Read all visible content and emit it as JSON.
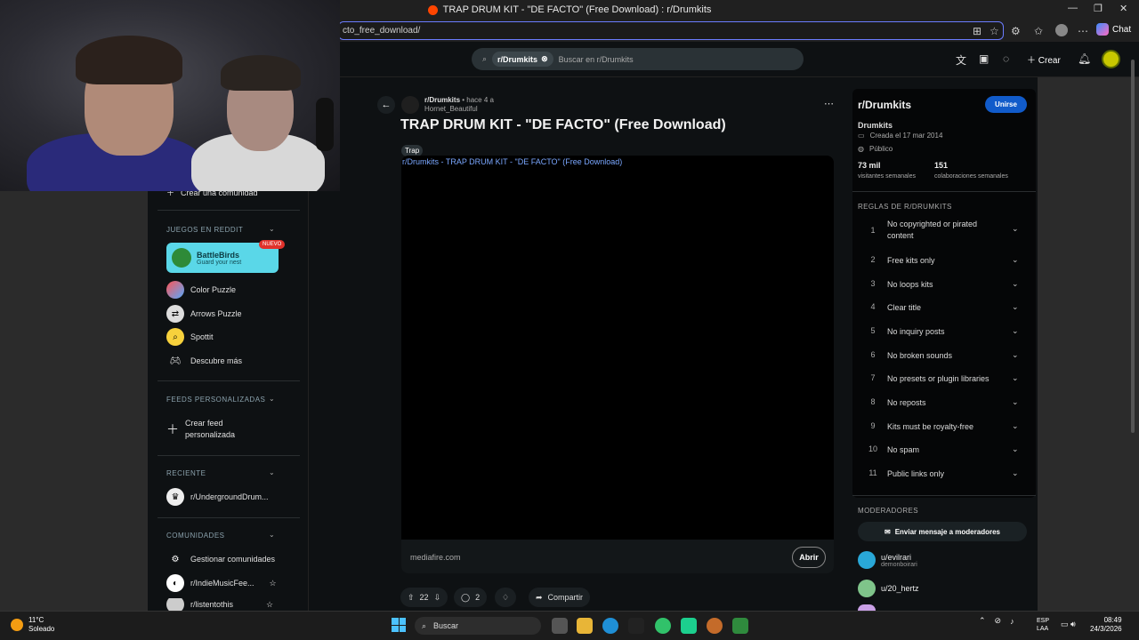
{
  "browser": {
    "tab_title": "TRAP DRUM KIT - \"DE FACTO\" (Free Download) : r/Drumkits",
    "address": "cto_free_download/",
    "chat_label": "Chat"
  },
  "header": {
    "search_chip": "r/Drumkits",
    "search_placeholder": "Buscar en r/Drumkits",
    "create_label": "Crear"
  },
  "left_sidebar": {
    "create_community": "Crear una comunidad",
    "games_header": "JUEGOS EN REDDIT",
    "battle": {
      "title": "BattleBirds",
      "subtitle": "Guard your nest",
      "badge": "NUEVO"
    },
    "games": [
      "Color Puzzle",
      "Arrows Puzzle",
      "Spottit",
      "Descubre más"
    ],
    "feeds_header": "FEEDS PERSONALIZADAS",
    "create_feed": "Crear feed personalizada",
    "recent_header": "RECIENTE",
    "recent": [
      "r/UndergroundDrum..."
    ],
    "communities_header": "COMUNIDADES",
    "communities": [
      "Gestionar comunidades",
      "r/IndieMusicFee...",
      "r/listentothis"
    ]
  },
  "post": {
    "subreddit": "r/Drumkits",
    "age": "• hace 4 a",
    "author": "Hornet_Beautiful",
    "title": "TRAP DRUM KIT - \"DE FACTO\" (Free Download)",
    "flair": "Trap",
    "media_alt": "r/Drumkits - TRAP DRUM KIT - \"DE FACTO\" (Free Download)",
    "domain": "mediafire.com",
    "open_label": "Abrir",
    "votes": "22",
    "comments": "2",
    "share_label": "Compartir"
  },
  "right_sidebar": {
    "name": "r/Drumkits",
    "join_label": "Unirse",
    "title": "Drumkits",
    "created": "Creada el 17 mar 2014",
    "visibility": "Público",
    "visitors": "73 mil",
    "visitors_label": "visitantes semanales",
    "contributions": "151",
    "contributions_label": "colaboraciones semanales",
    "rules_header": "REGLAS DE R/DRUMKITS",
    "rules": [
      {
        "n": "1",
        "t": "No copyrighted or pirated content"
      },
      {
        "n": "2",
        "t": "Free kits only"
      },
      {
        "n": "3",
        "t": "No loops kits"
      },
      {
        "n": "4",
        "t": "Clear title"
      },
      {
        "n": "5",
        "t": "No inquiry posts"
      },
      {
        "n": "6",
        "t": "No broken sounds"
      },
      {
        "n": "7",
        "t": "No presets or plugin libraries"
      },
      {
        "n": "8",
        "t": "No reposts"
      },
      {
        "n": "9",
        "t": "Kits must be royalty-free"
      },
      {
        "n": "10",
        "t": "No spam"
      },
      {
        "n": "11",
        "t": "Public links only"
      }
    ],
    "mods_header": "MODERADORES",
    "message_mods": "Enviar mensaje a moderadores",
    "mods": [
      {
        "name": "u/evilrari",
        "flair": "demonboirari"
      },
      {
        "name": "u/20_hertz",
        "flair": ""
      }
    ]
  },
  "taskbar": {
    "temp": "11°C",
    "weather": "Soleado",
    "search": "Buscar",
    "lang1": "ESP",
    "lang2": "LAA",
    "time": "08:49",
    "date": "24/3/2026"
  }
}
